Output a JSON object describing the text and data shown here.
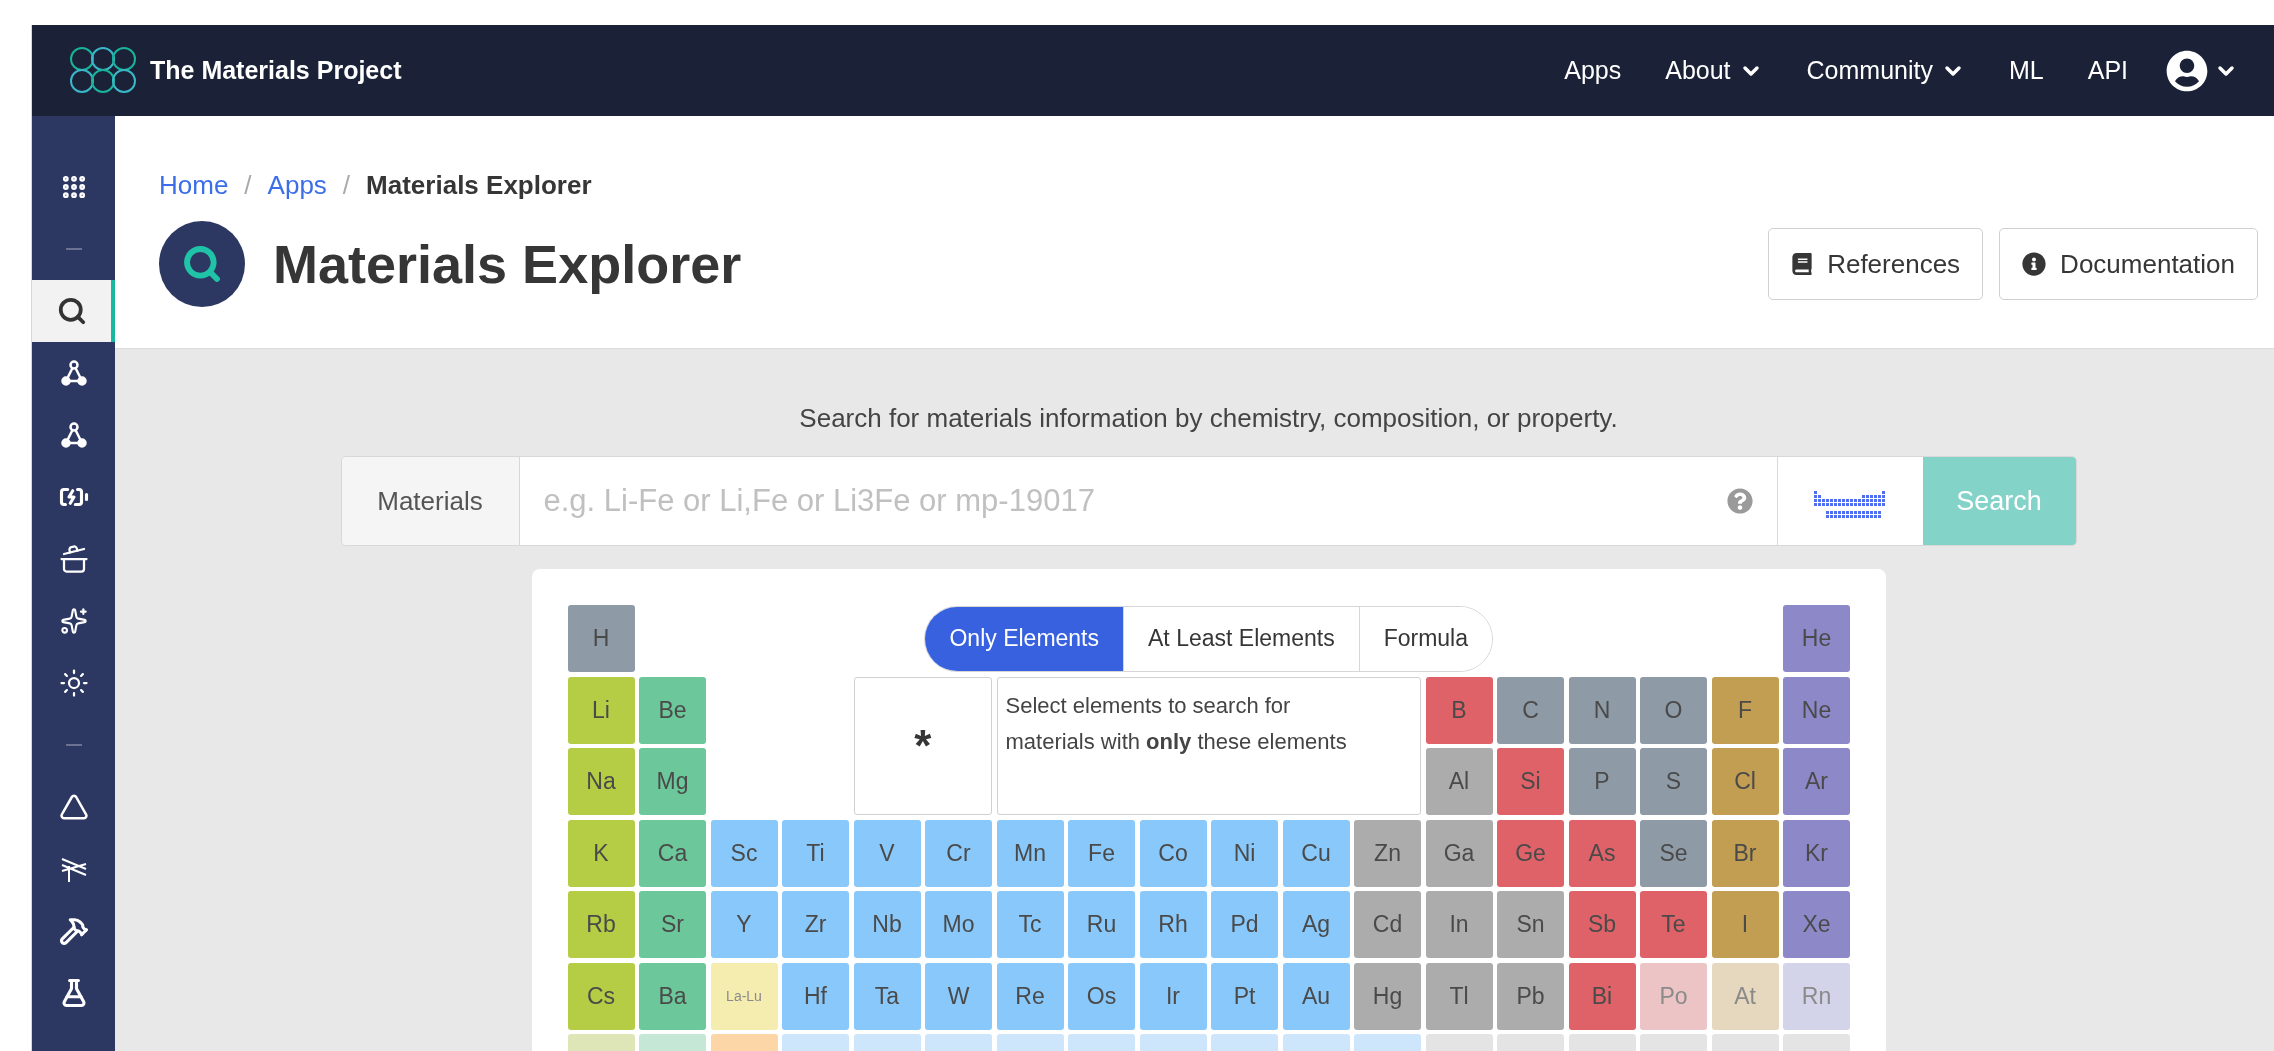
{
  "navbar": {
    "title": "The Materials Project",
    "items": [
      {
        "label": "Apps",
        "dropdown": false
      },
      {
        "label": "About",
        "dropdown": true
      },
      {
        "label": "Community",
        "dropdown": true
      },
      {
        "label": "ML",
        "dropdown": false
      },
      {
        "label": "API",
        "dropdown": false
      }
    ]
  },
  "sidebar": {
    "items": [
      {
        "kind": "button",
        "selected": false
      },
      {
        "kind": "divider"
      },
      {
        "kind": "button",
        "selected": true
      },
      {
        "kind": "button",
        "selected": false
      },
      {
        "kind": "button",
        "selected": false
      },
      {
        "kind": "button",
        "selected": false
      },
      {
        "kind": "button",
        "selected": false
      },
      {
        "kind": "button",
        "selected": false
      },
      {
        "kind": "button",
        "selected": false
      },
      {
        "kind": "divider"
      },
      {
        "kind": "button",
        "selected": false
      },
      {
        "kind": "button",
        "selected": false
      },
      {
        "kind": "button",
        "selected": false
      },
      {
        "kind": "button",
        "selected": false
      }
    ]
  },
  "breadcrumb": [
    {
      "kind": "link",
      "label": "Home"
    },
    {
      "kind": "separator",
      "label": "/"
    },
    {
      "kind": "link",
      "label": "Apps"
    },
    {
      "kind": "separator",
      "label": "/"
    },
    {
      "kind": "current",
      "label": "Materials Explorer"
    }
  ],
  "page_title": "Materials Explorer",
  "header_buttons": [
    "References",
    "Documentation"
  ],
  "search": {
    "caption": "Search for materials information by chemistry, composition, or property.",
    "label": "Materials",
    "placeholder": "e.g. Li-Fe or Li,Fe or Li3Fe or mp-19017",
    "button": "Search",
    "table_toggle_on": true
  },
  "mode_tabs": [
    {
      "label": "Only Elements",
      "selected": true
    },
    {
      "label": "At Least Elements",
      "selected": false
    },
    {
      "label": "Formula",
      "selected": false
    }
  ],
  "wildcard": "*",
  "hint": "Select elements to search for materials with **only** these elements",
  "periodic_table": [
    [
      {
        "kind": "element",
        "symbol": "H",
        "color": "#8e9ba6",
        "disabled": false
      },
      {
        "kind": "element",
        "symbol": "He",
        "color": "#8d89c9",
        "disabled": false
      }
    ],
    [
      {
        "kind": "element",
        "symbol": "Li",
        "color": "#b5cc45",
        "disabled": false
      },
      {
        "kind": "element",
        "symbol": "Be",
        "color": "#6cc79a",
        "disabled": false
      },
      {
        "kind": "element",
        "symbol": "B",
        "color": "#de6268",
        "disabled": false
      },
      {
        "kind": "element",
        "symbol": "C",
        "color": "#8e9ba6",
        "disabled": false
      },
      {
        "kind": "element",
        "symbol": "N",
        "color": "#8e9ba6",
        "disabled": false
      },
      {
        "kind": "element",
        "symbol": "O",
        "color": "#8e9ba6",
        "disabled": false
      },
      {
        "kind": "element",
        "symbol": "F",
        "color": "#c29e52",
        "disabled": false
      },
      {
        "kind": "element",
        "symbol": "Ne",
        "color": "#8d89c9",
        "disabled": false
      }
    ],
    [
      {
        "kind": "element",
        "symbol": "Na",
        "color": "#b5cc45",
        "disabled": false
      },
      {
        "kind": "element",
        "symbol": "Mg",
        "color": "#6cc79a",
        "disabled": false
      },
      {
        "kind": "element",
        "symbol": "Al",
        "color": "#acacac",
        "disabled": false
      },
      {
        "kind": "element",
        "symbol": "Si",
        "color": "#de6268",
        "disabled": false
      },
      {
        "kind": "element",
        "symbol": "P",
        "color": "#8e9ba6",
        "disabled": false
      },
      {
        "kind": "element",
        "symbol": "S",
        "color": "#8e9ba6",
        "disabled": false
      },
      {
        "kind": "element",
        "symbol": "Cl",
        "color": "#c29e52",
        "disabled": false
      },
      {
        "kind": "element",
        "symbol": "Ar",
        "color": "#8d89c9",
        "disabled": false
      }
    ],
    [
      {
        "kind": "element",
        "symbol": "K",
        "color": "#b5cc45",
        "disabled": false
      },
      {
        "kind": "element",
        "symbol": "Ca",
        "color": "#6cc79a",
        "disabled": false
      },
      {
        "kind": "element",
        "symbol": "Sc",
        "color": "#88c8fa",
        "disabled": false
      },
      {
        "kind": "element",
        "symbol": "Ti",
        "color": "#88c8fa",
        "disabled": false
      },
      {
        "kind": "element",
        "symbol": "V",
        "color": "#88c8fa",
        "disabled": false
      },
      {
        "kind": "element",
        "symbol": "Cr",
        "color": "#88c8fa",
        "disabled": false
      },
      {
        "kind": "element",
        "symbol": "Mn",
        "color": "#88c8fa",
        "disabled": false
      },
      {
        "kind": "element",
        "symbol": "Fe",
        "color": "#88c8fa",
        "disabled": false
      },
      {
        "kind": "element",
        "symbol": "Co",
        "color": "#88c8fa",
        "disabled": false
      },
      {
        "kind": "element",
        "symbol": "Ni",
        "color": "#88c8fa",
        "disabled": false
      },
      {
        "kind": "element",
        "symbol": "Cu",
        "color": "#88c8fa",
        "disabled": false
      },
      {
        "kind": "element",
        "symbol": "Zn",
        "color": "#acacac",
        "disabled": false
      },
      {
        "kind": "element",
        "symbol": "Ga",
        "color": "#acacac",
        "disabled": false
      },
      {
        "kind": "element",
        "symbol": "Ge",
        "color": "#de6268",
        "disabled": false
      },
      {
        "kind": "element",
        "symbol": "As",
        "color": "#de6268",
        "disabled": false
      },
      {
        "kind": "element",
        "symbol": "Se",
        "color": "#8e9ba6",
        "disabled": false
      },
      {
        "kind": "element",
        "symbol": "Br",
        "color": "#c29e52",
        "disabled": false
      },
      {
        "kind": "element",
        "symbol": "Kr",
        "color": "#8d89c9",
        "disabled": false
      }
    ],
    [
      {
        "kind": "element",
        "symbol": "Rb",
        "color": "#b5cc45",
        "disabled": false
      },
      {
        "kind": "element",
        "symbol": "Sr",
        "color": "#6cc79a",
        "disabled": false
      },
      {
        "kind": "element",
        "symbol": "Y",
        "color": "#88c8fa",
        "disabled": false
      },
      {
        "kind": "element",
        "symbol": "Zr",
        "color": "#88c8fa",
        "disabled": false
      },
      {
        "kind": "element",
        "symbol": "Nb",
        "color": "#88c8fa",
        "disabled": false
      },
      {
        "kind": "element",
        "symbol": "Mo",
        "color": "#88c8fa",
        "disabled": false
      },
      {
        "kind": "element",
        "symbol": "Tc",
        "color": "#88c8fa",
        "disabled": false
      },
      {
        "kind": "element",
        "symbol": "Ru",
        "color": "#88c8fa",
        "disabled": false
      },
      {
        "kind": "element",
        "symbol": "Rh",
        "color": "#88c8fa",
        "disabled": false
      },
      {
        "kind": "element",
        "symbol": "Pd",
        "color": "#88c8fa",
        "disabled": false
      },
      {
        "kind": "element",
        "symbol": "Ag",
        "color": "#88c8fa",
        "disabled": false
      },
      {
        "kind": "element",
        "symbol": "Cd",
        "color": "#acacac",
        "disabled": false
      },
      {
        "kind": "element",
        "symbol": "In",
        "color": "#acacac",
        "disabled": false
      },
      {
        "kind": "element",
        "symbol": "Sn",
        "color": "#acacac",
        "disabled": false
      },
      {
        "kind": "element",
        "symbol": "Sb",
        "color": "#de6268",
        "disabled": false
      },
      {
        "kind": "element",
        "symbol": "Te",
        "color": "#de6268",
        "disabled": false
      },
      {
        "kind": "element",
        "symbol": "I",
        "color": "#c29e52",
        "disabled": false
      },
      {
        "kind": "element",
        "symbol": "Xe",
        "color": "#8d89c9",
        "disabled": false
      }
    ],
    [
      {
        "kind": "element",
        "symbol": "Cs",
        "color": "#b5cc45",
        "disabled": false
      },
      {
        "kind": "element",
        "symbol": "Ba",
        "color": "#6cc79a",
        "disabled": false
      },
      {
        "kind": "range",
        "symbol": "La-Lu",
        "color": "#f5edb0",
        "disabled": true
      },
      {
        "kind": "element",
        "symbol": "Hf",
        "color": "#88c8fa",
        "disabled": false
      },
      {
        "kind": "element",
        "symbol": "Ta",
        "color": "#88c8fa",
        "disabled": false
      },
      {
        "kind": "element",
        "symbol": "W",
        "color": "#88c8fa",
        "disabled": false
      },
      {
        "kind": "element",
        "symbol": "Re",
        "color": "#88c8fa",
        "disabled": false
      },
      {
        "kind": "element",
        "symbol": "Os",
        "color": "#88c8fa",
        "disabled": false
      },
      {
        "kind": "element",
        "symbol": "Ir",
        "color": "#88c8fa",
        "disabled": false
      },
      {
        "kind": "element",
        "symbol": "Pt",
        "color": "#88c8fa",
        "disabled": false
      },
      {
        "kind": "element",
        "symbol": "Au",
        "color": "#88c8fa",
        "disabled": false
      },
      {
        "kind": "element",
        "symbol": "Hg",
        "color": "#acacac",
        "disabled": false
      },
      {
        "kind": "element",
        "symbol": "Tl",
        "color": "#acacac",
        "disabled": false
      },
      {
        "kind": "element",
        "symbol": "Pb",
        "color": "#acacac",
        "disabled": false
      },
      {
        "kind": "element",
        "symbol": "Bi",
        "color": "#de6268",
        "disabled": false
      },
      {
        "kind": "element",
        "symbol": "Po",
        "color": "#edc4c5",
        "disabled": true
      },
      {
        "kind": "element",
        "symbol": "At",
        "color": "#e6d7bf",
        "disabled": true
      },
      {
        "kind": "element",
        "symbol": "Rn",
        "color": "#d3d3ea",
        "disabled": true
      }
    ],
    [
      {
        "kind": "cut",
        "color": "#dee6b8"
      },
      {
        "kind": "cut",
        "color": "#c5e7d6"
      },
      {
        "kind": "cut",
        "color": "#fcd6a6"
      },
      {
        "kind": "cut",
        "color": "#cde6fb"
      },
      {
        "kind": "cut",
        "color": "#cde6fb"
      },
      {
        "kind": "cut",
        "color": "#cde6fb"
      },
      {
        "kind": "cut",
        "color": "#cde6fb"
      },
      {
        "kind": "cut",
        "color": "#cde6fb"
      },
      {
        "kind": "cut",
        "color": "#cde6fb"
      },
      {
        "kind": "cut",
        "color": "#cde6fb"
      },
      {
        "kind": "cut",
        "color": "#cde6fb"
      },
      {
        "kind": "cut",
        "color": "#cde6fb"
      },
      {
        "kind": "cut",
        "color": "#e4e4e4"
      },
      {
        "kind": "cut",
        "color": "#e4e4e4"
      },
      {
        "kind": "cut",
        "color": "#e4e4e4"
      },
      {
        "kind": "cut",
        "color": "#e4e4e4"
      },
      {
        "kind": "cut",
        "color": "#e4e4e4"
      },
      {
        "kind": "cut",
        "color": "#e4e4e4"
      }
    ]
  ]
}
